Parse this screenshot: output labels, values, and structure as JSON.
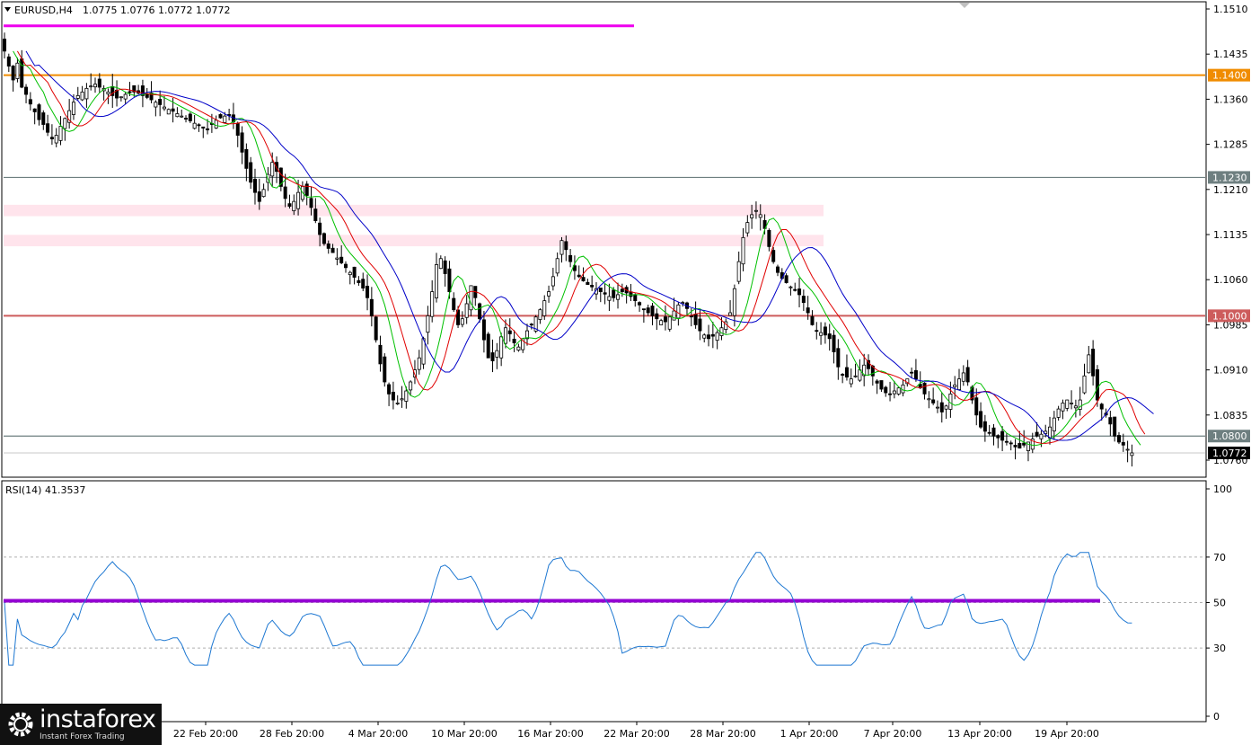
{
  "header": {
    "symbol": "EURUSD,H4",
    "ohlc": "1.0775 1.0776 1.0772 1.0772",
    "menu_icon": "triangle-down-icon"
  },
  "rsi_header": "RSI(14) 41.3537",
  "logo": {
    "brand": "instaforex",
    "tagline": "Instant Forex Trading",
    "icon": "gear-logo-icon"
  },
  "chart_data": [
    {
      "type": "candlestick",
      "symbol": "EURUSD",
      "timeframe": "H4",
      "ylim": [
        1.0715,
        1.1535
      ],
      "y_ticks": [
        "1.1510",
        "1.1435",
        "1.1360",
        "1.1285",
        "1.1210",
        "1.1135",
        "1.1060",
        "1.0985",
        "1.0910",
        "1.0835",
        "1.0760"
      ],
      "x_ticks": [
        "22 Feb 20:00",
        "28 Feb 20:00",
        "4 Mar 20:00",
        "10 Mar 20:00",
        "16 Mar 20:00",
        "22 Mar 20:00",
        "28 Mar 20:00",
        "1 Apr 20:00",
        "7 Apr 20:00",
        "13 Apr 20:00",
        "19 Apr 20:00"
      ],
      "current_price": "1.0772",
      "current_price_color": "#000000",
      "levels": [
        {
          "label": "1.1400",
          "value": 1.14,
          "color": "#f08c00"
        },
        {
          "label": "1.1230",
          "value": 1.123,
          "color": "#6e7f80"
        },
        {
          "label": "1.1000",
          "value": 1.1,
          "color": "#cd5c5c"
        },
        {
          "label": "1.0800",
          "value": 1.08,
          "color": "#6e7f80"
        }
      ],
      "magenta_line": {
        "value": 1.1482,
        "color": "#ee00ee"
      },
      "zones": [
        {
          "from": 1.117,
          "to": 1.118,
          "color": "#ffe4ec"
        },
        {
          "from": 1.112,
          "to": 1.113,
          "color": "#ffe4ec"
        }
      ],
      "close": [
        1.144,
        1.1415,
        1.1392,
        1.142,
        1.138,
        1.1368,
        1.1352,
        1.1339,
        1.1326,
        1.1318,
        1.1305,
        1.1294,
        1.13,
        1.1315,
        1.1328,
        1.1341,
        1.1355,
        1.1366,
        1.1372,
        1.1378,
        1.1382,
        1.1385,
        1.138,
        1.1378,
        1.1372,
        1.1366,
        1.1362,
        1.1364,
        1.1368,
        1.1371,
        1.1372,
        1.137,
        1.1366,
        1.1363,
        1.1359,
        1.1355,
        1.1351,
        1.1347,
        1.1343,
        1.134,
        1.1336,
        1.1332,
        1.1328,
        1.1324,
        1.132,
        1.1316,
        1.1312,
        1.1309,
        1.1318,
        1.1325,
        1.1329,
        1.1332,
        1.1333,
        1.1322,
        1.13,
        1.1272,
        1.1245,
        1.1222,
        1.1205,
        1.119,
        1.121,
        1.1235,
        1.1255,
        1.124,
        1.1215,
        1.1195,
        1.1182,
        1.119,
        1.1205,
        1.1215,
        1.12,
        1.118,
        1.1158,
        1.1135,
        1.112,
        1.1112,
        1.1105,
        1.1096,
        1.1088,
        1.108,
        1.1072,
        1.1064,
        1.1055,
        1.1046,
        1.103,
        1.1,
        1.096,
        1.092,
        1.089,
        1.087,
        1.086,
        1.0855,
        1.0862,
        1.0875,
        1.089,
        1.091,
        1.093,
        1.0962,
        1.1,
        1.104,
        1.1085,
        1.1095,
        1.107,
        1.104,
        1.101,
        1.0985,
        1.0995,
        1.102,
        1.105,
        1.103,
        1.0995,
        1.096,
        1.093,
        1.0925,
        1.0942,
        1.0965,
        1.098,
        1.097,
        1.0955,
        1.0948,
        1.0962,
        1.0975,
        1.0985,
        1.0998,
        1.101,
        1.1025,
        1.104,
        1.1065,
        1.1095,
        1.1125,
        1.111,
        1.109,
        1.1075,
        1.1065,
        1.1058,
        1.1052,
        1.1048,
        1.1045,
        1.104,
        1.1036,
        1.1032,
        1.103,
        1.1035,
        1.104,
        1.1038,
        1.1032,
        1.1025,
        1.1018,
        1.101,
        1.1005,
        1.1,
        1.0995,
        1.0992,
        1.099,
        1.0998,
        1.1008,
        1.1018,
        1.1022,
        1.1012,
        1.0998,
        1.0985,
        1.0975,
        1.0968,
        1.0962,
        1.0966,
        1.0972,
        1.098,
        1.099,
        1.1005,
        1.1045,
        1.109,
        1.113,
        1.1155,
        1.1168,
        1.1175,
        1.1168,
        1.1145,
        1.1115,
        1.109,
        1.1072,
        1.1062,
        1.1055,
        1.1048,
        1.1042,
        1.1035,
        1.1022,
        1.1005,
        1.0985,
        1.0975,
        1.0972,
        1.0968,
        1.0962,
        1.094,
        1.0915,
        1.0902,
        1.0898,
        1.0895,
        1.09,
        1.091,
        1.0918,
        1.0912,
        1.09,
        1.0888,
        1.0878,
        1.0872,
        1.087,
        1.0875,
        1.088,
        1.0885,
        1.0895,
        1.0905,
        1.0895,
        1.088,
        1.087,
        1.0862,
        1.0855,
        1.0848,
        1.084,
        1.085,
        1.087,
        1.0885,
        1.0895,
        1.0905,
        1.089,
        1.086,
        1.0835,
        1.0815,
        1.0808,
        1.0805,
        1.08,
        1.0797,
        1.0793,
        1.079,
        1.0787,
        1.0782,
        1.078,
        1.0785,
        1.079,
        1.0795,
        1.08,
        1.0803,
        1.0808,
        1.0815,
        1.083,
        1.0845,
        1.0855,
        1.086,
        1.0855,
        1.085,
        1.086,
        1.09,
        1.0935,
        1.09,
        1.086,
        1.0845,
        1.0835,
        1.082,
        1.08,
        1.079,
        1.0785,
        1.0778,
        1.0772
      ],
      "ma_series": [
        {
          "period": 5,
          "color": "#00c000"
        },
        {
          "period": 8,
          "color": "#e00000"
        },
        {
          "period": 13,
          "color": "#0000c8"
        }
      ]
    },
    {
      "type": "line",
      "indicator": "RSI",
      "period": 14,
      "ylim": [
        0,
        100
      ],
      "y_ticks": [
        "100",
        "70",
        "50",
        "30",
        "0"
      ],
      "levels": [
        70,
        50,
        30
      ],
      "highlight_level": {
        "value": 50,
        "color": "#9400d3"
      },
      "line_color": "#1e78d2"
    }
  ]
}
